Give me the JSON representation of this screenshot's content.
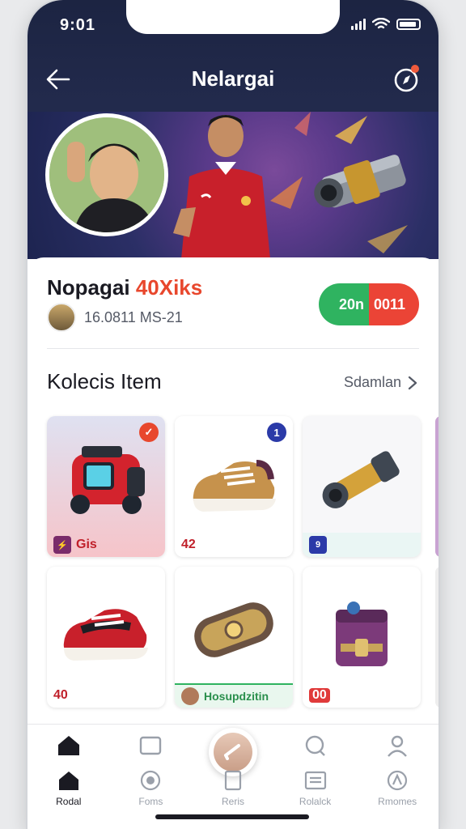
{
  "status": {
    "time": "9:01"
  },
  "nav": {
    "title": "Nelargai"
  },
  "player": {
    "name_main": "Nopagai",
    "name_accent": "40Xiks",
    "subtitle": "16.0811 MS-21",
    "toggle_left": "20n",
    "toggle_right": "0011"
  },
  "section": {
    "title": "Kolecis Item",
    "see_all": "Sdamlan"
  },
  "items": [
    {
      "name": "robot-item",
      "badge": "✓",
      "badge_color": "#e8472d",
      "foot_icon": "⚡",
      "foot_icon_color": "#7a2b6a",
      "foot_label": "Gis"
    },
    {
      "name": "sneaker-item",
      "badge": "1",
      "badge_color": "#2b3aa8",
      "foot_icon": "",
      "foot_icon_color": "",
      "foot_label": "42"
    },
    {
      "name": "cannon-item",
      "badge": "",
      "badge_color": "",
      "foot_icon": "9",
      "foot_icon_color": "#2b3aa8",
      "foot_label": ""
    },
    {
      "name": "red-sneaker-item",
      "badge": "",
      "badge_color": "",
      "foot_icon": "",
      "foot_icon_color": "",
      "foot_label": "40"
    },
    {
      "name": "bracelet-item",
      "badge": "",
      "badge_color": "",
      "foot_icon": "",
      "foot_icon_color": "",
      "foot_label": "Hosupdzitin"
    },
    {
      "name": "purse-item",
      "badge": "",
      "badge_color": "",
      "foot_icon": "",
      "foot_icon_color": "",
      "foot_label": "00"
    }
  ],
  "tabs_top": [
    "",
    "",
    "",
    "",
    ""
  ],
  "tabs_bottom": [
    {
      "label": "Rodal",
      "icon": "home-icon"
    },
    {
      "label": "Foms",
      "icon": "shield-icon"
    },
    {
      "label": "Reris",
      "icon": "doc-icon"
    },
    {
      "label": "Rolalck",
      "icon": "list-icon"
    },
    {
      "label": "Rmomes",
      "icon": "badge-icon"
    }
  ],
  "colors": {
    "accent": "#e8472d",
    "green": "#2fb360",
    "red": "#eb4436",
    "header": "#1c2442"
  }
}
